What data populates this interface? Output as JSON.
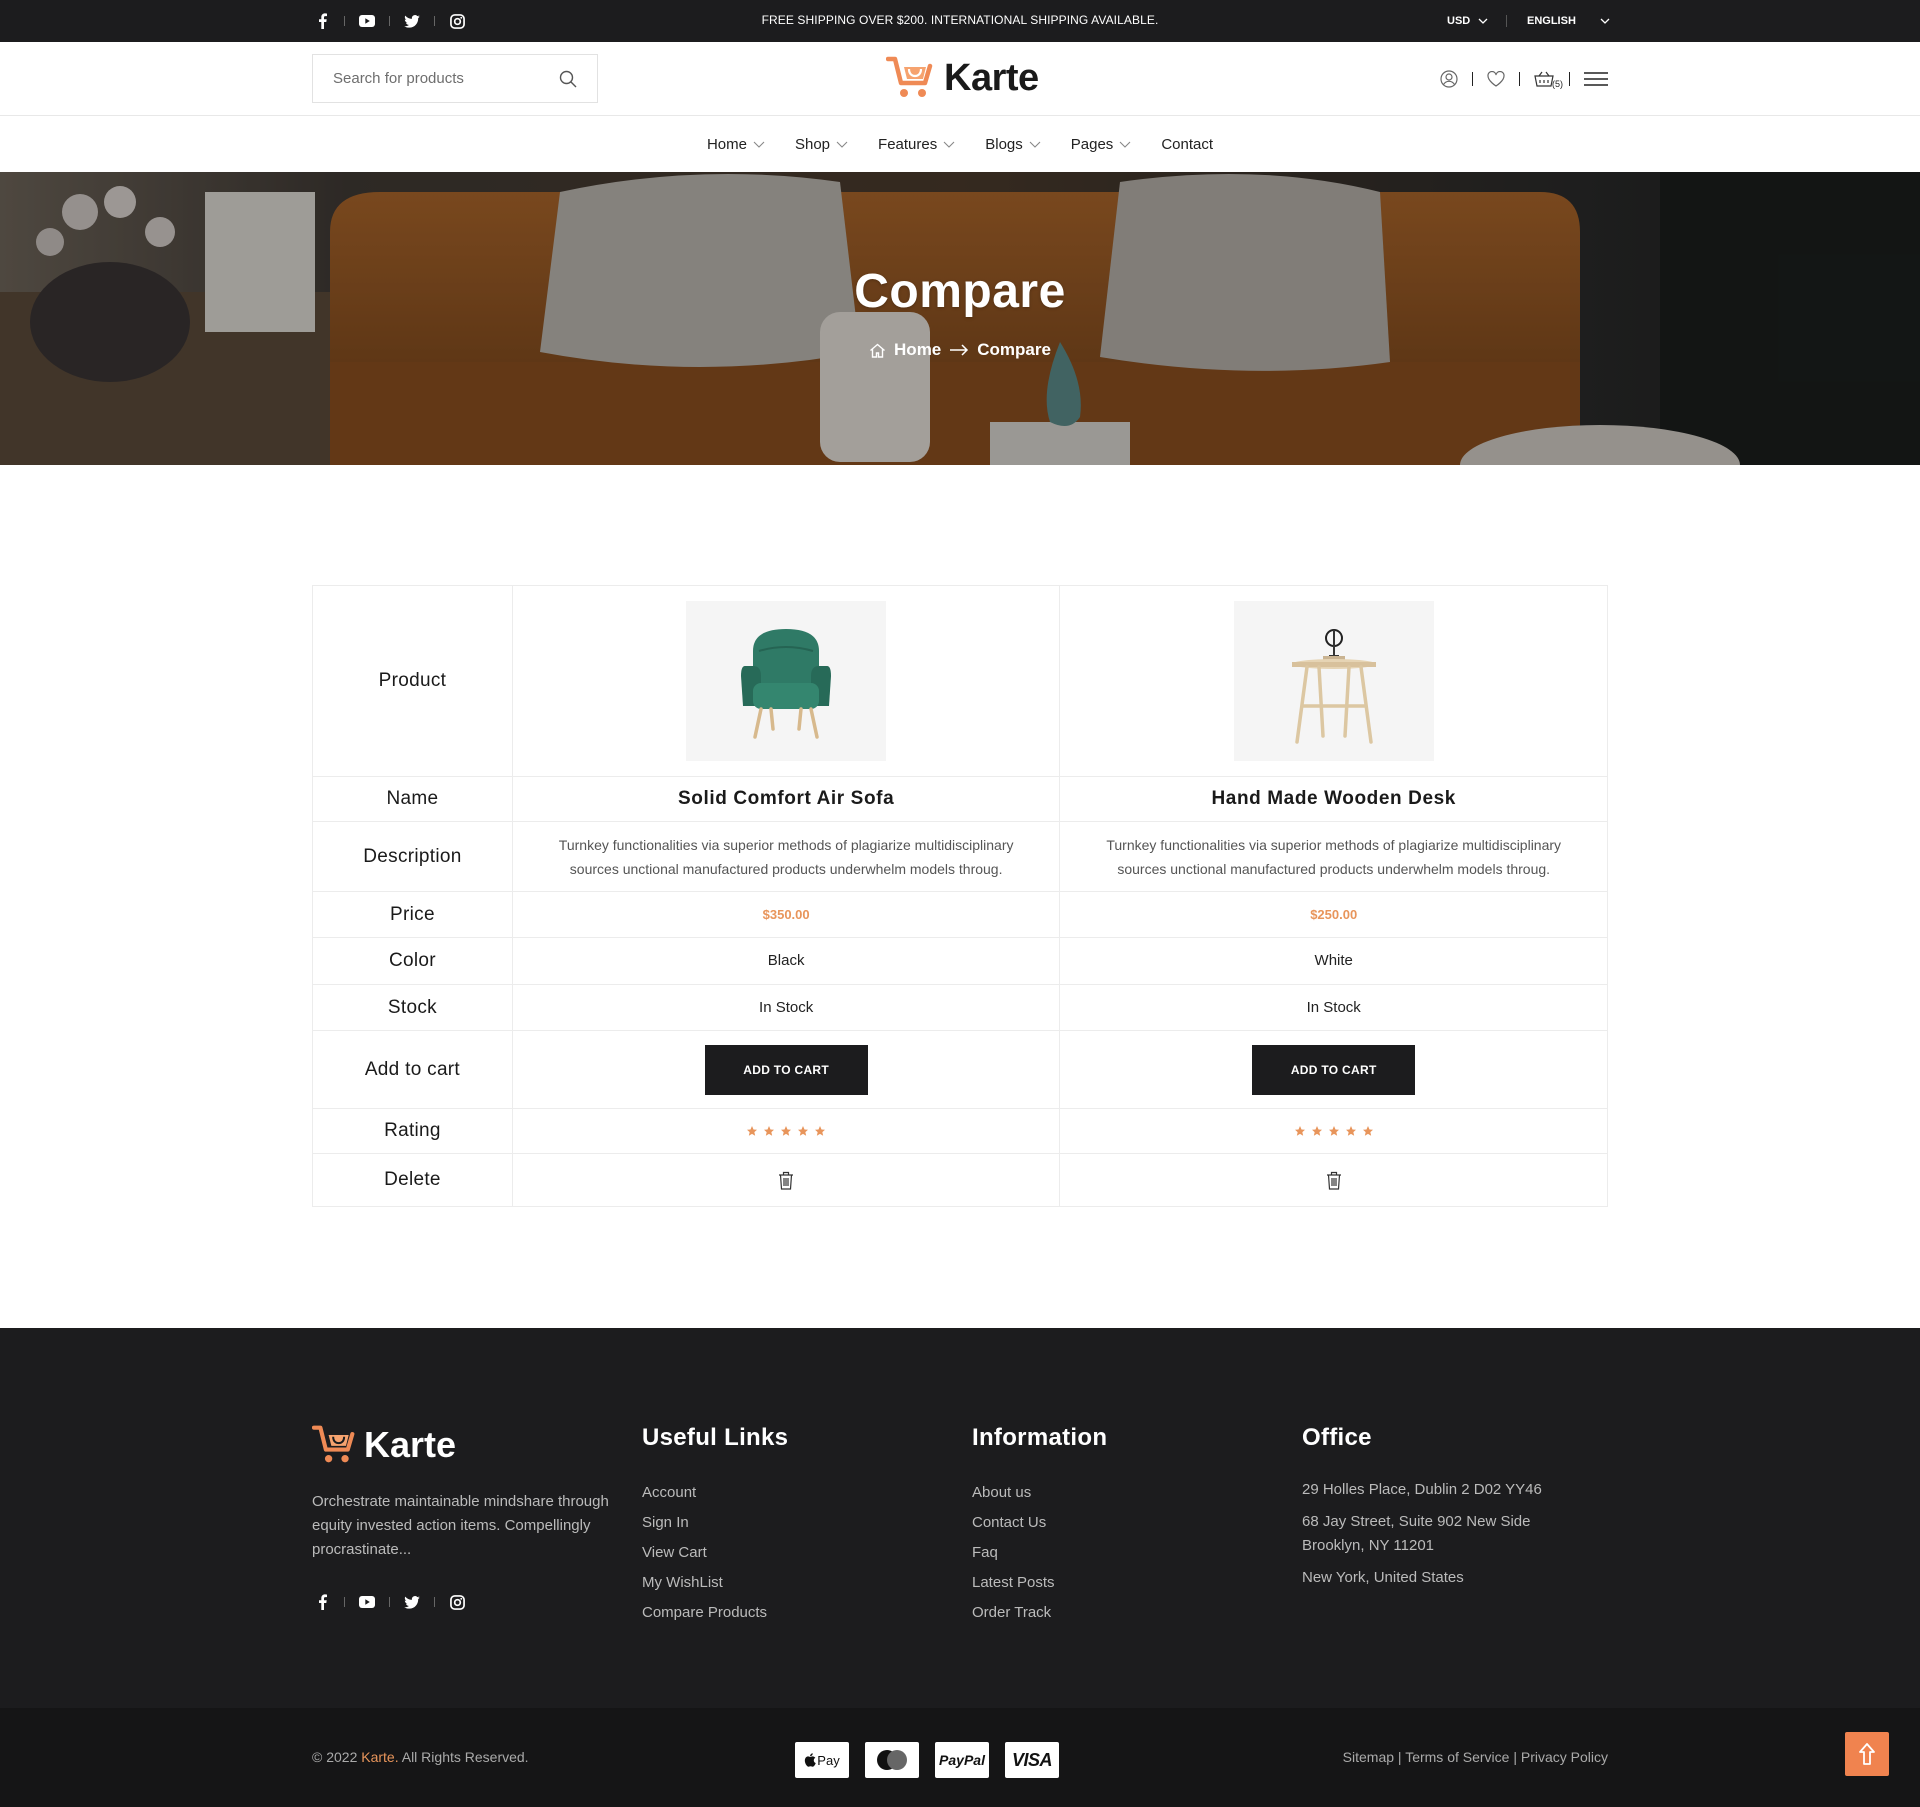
{
  "topbar": {
    "promo": "FREE SHIPPING OVER $200. INTERNATIONAL SHIPPING AVAILABLE.",
    "currency": "USD",
    "language": "ENGLISH",
    "social_icons": [
      "facebook-icon",
      "youtube-icon",
      "twitter-icon",
      "instagram-icon"
    ]
  },
  "header": {
    "search_placeholder": "Search for products",
    "logo_text": "Karte",
    "cart_count": "(5)",
    "icons": [
      "user-icon",
      "heart-icon",
      "cart-icon",
      "menu-icon"
    ]
  },
  "nav": {
    "items": [
      {
        "label": "Home",
        "dropdown": true
      },
      {
        "label": "Shop",
        "dropdown": true
      },
      {
        "label": "Features",
        "dropdown": true
      },
      {
        "label": "Blogs",
        "dropdown": true
      },
      {
        "label": "Pages",
        "dropdown": true
      },
      {
        "label": "Contact",
        "dropdown": false
      }
    ]
  },
  "hero": {
    "title": "Compare",
    "breadcrumb": {
      "home": "Home",
      "current": "Compare"
    }
  },
  "compare": {
    "labels": {
      "product": "Product",
      "name": "Name",
      "description": "Description",
      "price": "Price",
      "color": "Color",
      "stock": "Stock",
      "add_to_cart": "Add to cart",
      "rating": "Rating",
      "delete": "Delete"
    },
    "products": [
      {
        "name": "Solid Comfort Air Sofa",
        "description": "Turnkey functionalities via superior methods of plagiarize multidisciplinary sources unctional manufactured products underwhelm models throug.",
        "price": "$350.00",
        "color": "Black",
        "stock": "In Stock",
        "button": "ADD TO CART",
        "rating": 5
      },
      {
        "name": "Hand Made Wooden Desk",
        "description": "Turnkey functionalities via superior methods of plagiarize multidisciplinary sources unctional manufactured products underwhelm models throug.",
        "price": "$250.00",
        "color": "White",
        "stock": "In Stock",
        "button": "ADD TO CART",
        "rating": 5
      }
    ],
    "accent": "#e8955b"
  },
  "footer": {
    "logo_text": "Karte",
    "about": "Orchestrate maintainable mindshare through equity invested action items. Compellingly procrastinate...",
    "useful_links": {
      "title": "Useful Links",
      "items": [
        "Account",
        "Sign In",
        "View Cart",
        "My WishList",
        "Compare Products"
      ]
    },
    "information": {
      "title": "Information",
      "items": [
        "About us",
        "Contact Us",
        "Faq",
        "Latest Posts",
        "Order Track"
      ]
    },
    "office": {
      "title": "Office",
      "address1": "29 Holles Place, Dublin 2 D02 YY46",
      "address2": "68 Jay Street, Suite 902 New Side Brooklyn, NY 11201",
      "address3": "New York, United States"
    },
    "copyright_prefix": "© 2022",
    "copyright_brand": "Karte.",
    "copyright_suffix": "All Rights Reserved.",
    "payments": [
      "Pay",
      "PayPal",
      "VISA"
    ],
    "legal": "Sitemap | Terms of Service | Privacy Policy"
  }
}
